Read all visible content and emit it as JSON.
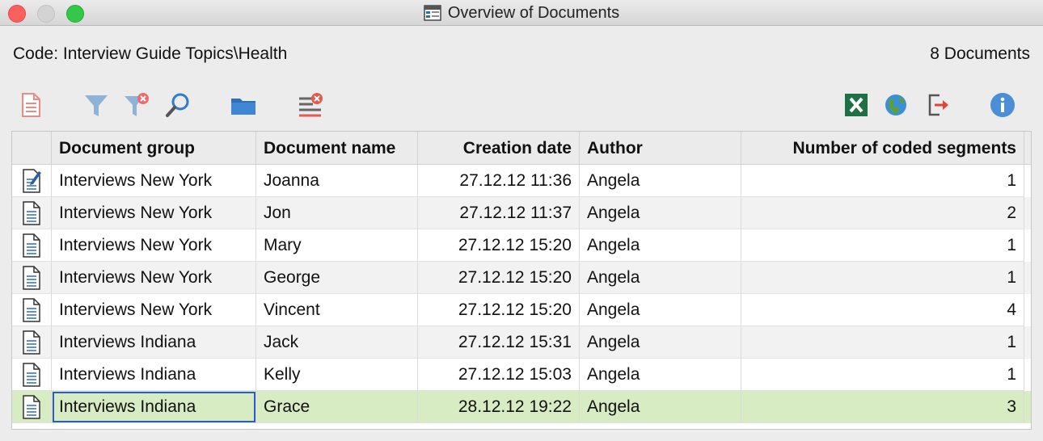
{
  "window": {
    "title": "Overview of Documents"
  },
  "info": {
    "code_label": "Code: Interview Guide Topics\\Health",
    "doc_count": "8 Documents"
  },
  "toolbar": {
    "left": [
      "document-icon",
      "filter-icon",
      "filter-clear-icon",
      "search-icon",
      "folder-icon",
      "list-remove-icon"
    ],
    "right": [
      "excel-icon",
      "globe-icon",
      "export-icon",
      "info-icon"
    ]
  },
  "colors": {
    "selected_row": "#d7ecc3",
    "focus": "#2a5cc9",
    "accent_blue": "#4a8fd6"
  },
  "table": {
    "columns": [
      "Document group",
      "Document name",
      "Creation date",
      "Author",
      "Number of coded segments"
    ],
    "rows": [
      {
        "icon": "memo-document-icon",
        "group": "Interviews New York",
        "name": "Joanna",
        "date": "27.12.12 11:36",
        "author": "Angela",
        "segments": "1"
      },
      {
        "icon": "text-document-icon",
        "group": "Interviews New York",
        "name": "Jon",
        "date": "27.12.12 11:37",
        "author": "Angela",
        "segments": "2"
      },
      {
        "icon": "text-document-icon",
        "group": "Interviews New York",
        "name": "Mary",
        "date": "27.12.12 15:20",
        "author": "Angela",
        "segments": "1"
      },
      {
        "icon": "text-document-icon",
        "group": "Interviews New York",
        "name": "George",
        "date": "27.12.12 15:20",
        "author": "Angela",
        "segments": "1"
      },
      {
        "icon": "text-document-icon",
        "group": "Interviews New York",
        "name": "Vincent",
        "date": "27.12.12 15:20",
        "author": "Angela",
        "segments": "4"
      },
      {
        "icon": "text-document-icon",
        "group": "Interviews Indiana",
        "name": "Jack",
        "date": "27.12.12 15:31",
        "author": "Angela",
        "segments": "1"
      },
      {
        "icon": "text-document-icon",
        "group": "Interviews Indiana",
        "name": "Kelly",
        "date": "27.12.12 15:03",
        "author": "Angela",
        "segments": "1"
      },
      {
        "icon": "text-document-icon",
        "group": "Interviews Indiana",
        "name": "Grace",
        "date": "28.12.12 19:22",
        "author": "Angela",
        "segments": "3",
        "selected": true
      }
    ]
  }
}
